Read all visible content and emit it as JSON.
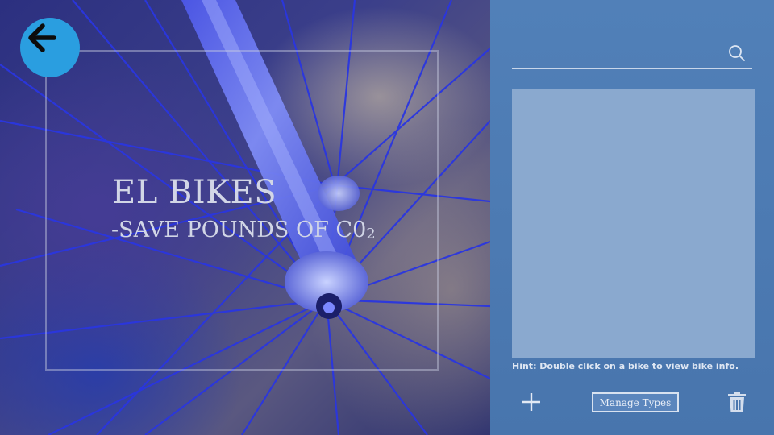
{
  "hero": {
    "title": "EL BIKES",
    "subtitle_main": "-SAVE POUNDS OF C0",
    "subtitle_sub": "2"
  },
  "navigation": {
    "back_icon": "arrow-left-icon"
  },
  "panel": {
    "search": {
      "value": "",
      "placeholder": "",
      "icon": "search-icon"
    },
    "bike_list": [],
    "hint": "Hint: Double click on a bike to view bike info.",
    "actions": {
      "add_icon": "plus-icon",
      "manage_types_label": "Manage Types",
      "delete_icon": "trash-icon"
    }
  },
  "colors": {
    "panel_bg": "#4a76ad",
    "list_bg": "#8aa9cf",
    "back_button": "#2a9ee0"
  }
}
